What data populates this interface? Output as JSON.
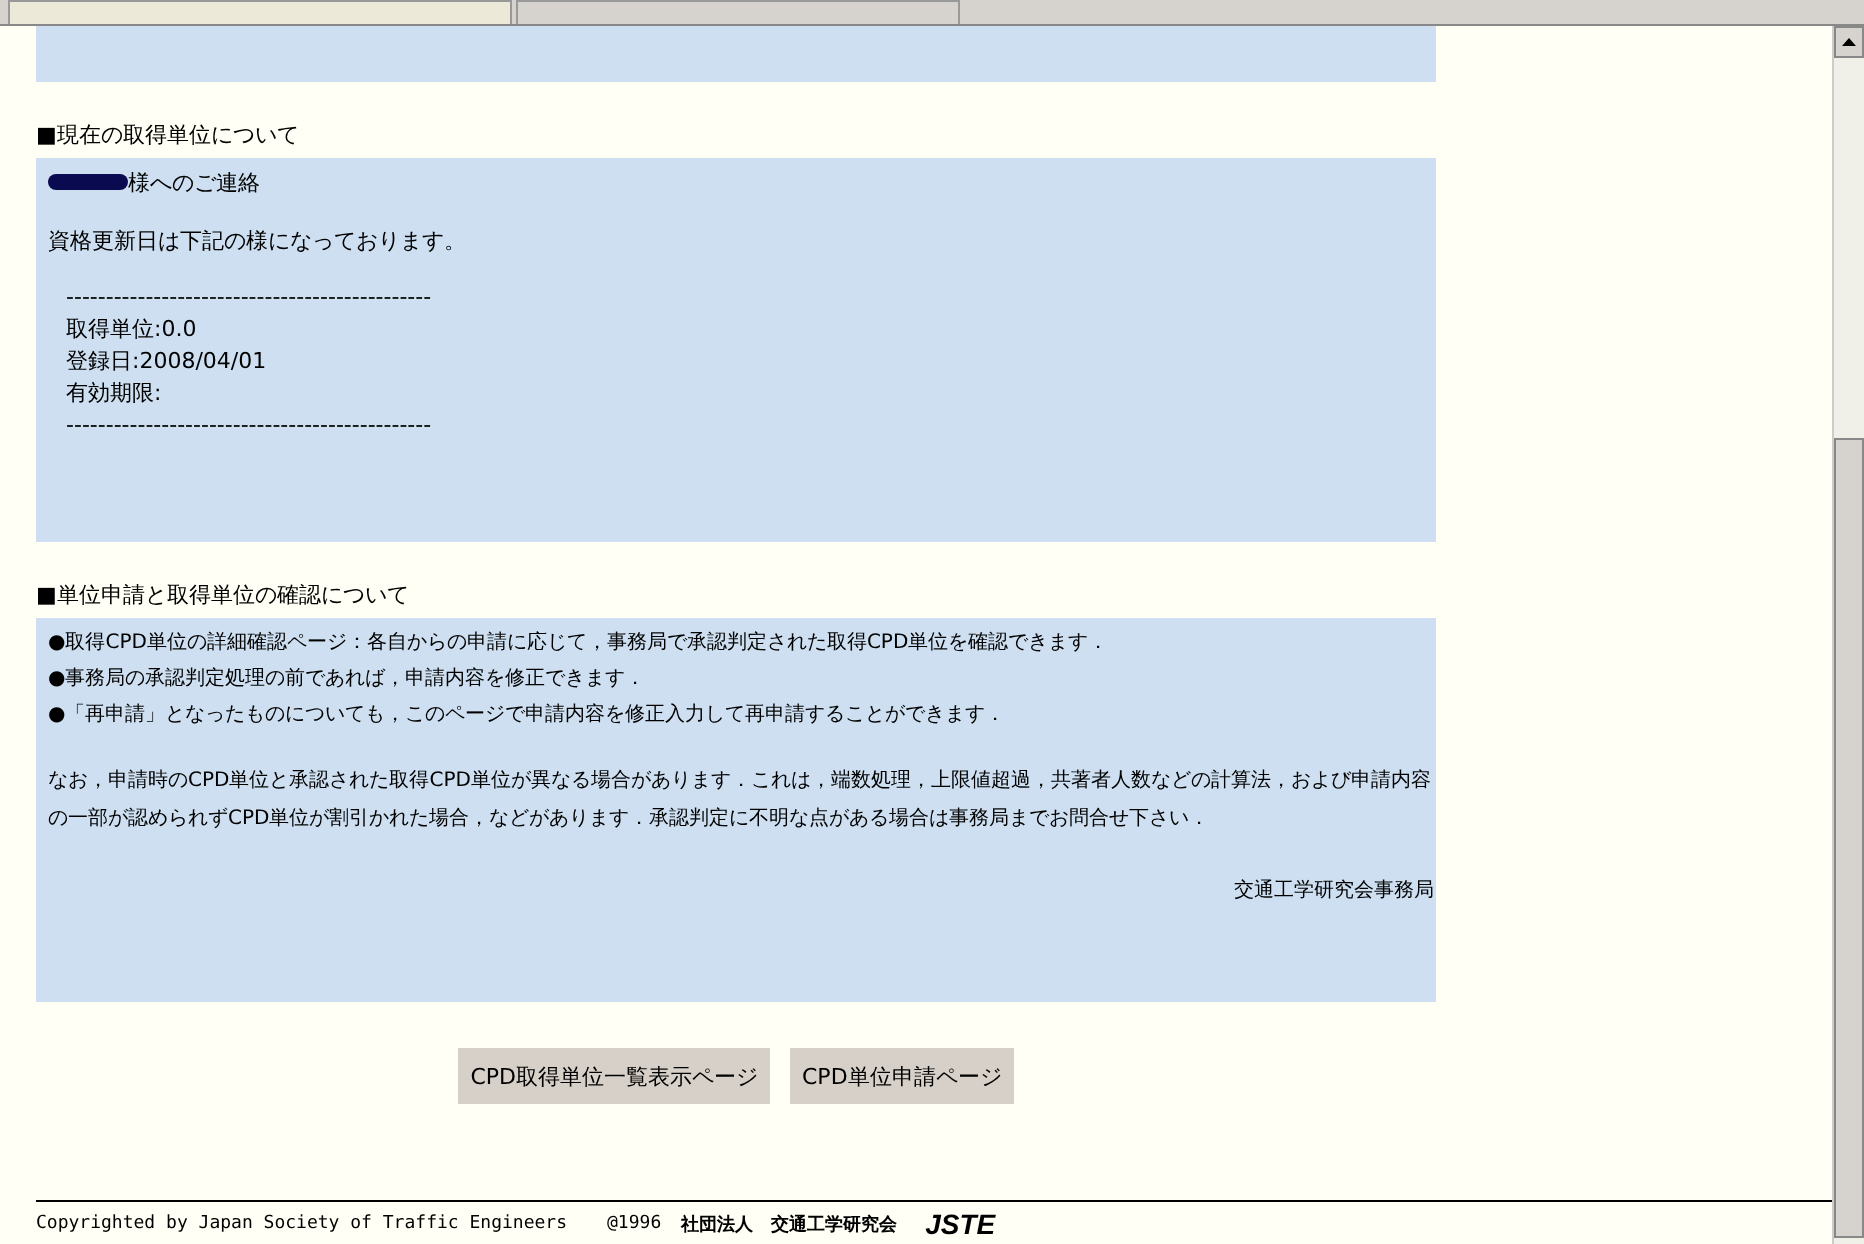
{
  "section_current": {
    "heading": "■現在の取得単位について",
    "greeting": "様へのご連絡",
    "intro": "資格更新日は下記の様になっております。",
    "separator": "----------------------------------------------",
    "lines": [
      "取得単位:0.0",
      "登録日:2008/04/01",
      "有効期限:"
    ]
  },
  "section_apply": {
    "heading": "■単位申請と取得単位の確認について",
    "bullets": [
      "●取得CPD単位の詳細確認ページ：各自からの申請に応じて，事務局で承認判定された取得CPD単位を確認できます．",
      "●事務局の承認判定処理の前であれば，申請内容を修正できます．",
      "●「再申請」となったものについても，このページで申請内容を修正入力して再申請することができます．"
    ],
    "note": "なお，申請時のCPD単位と承認された取得CPD単位が異なる場合があります．これは，端数処理，上限値超過，共著者人数などの計算法，および申請内容の一部が認められずCPD単位が割引かれた場合，などがあります．承認判定に不明な点がある場合は事務局までお問合せ下さい．",
    "signature": "交通工学研究会事務局"
  },
  "buttons": [
    "CPD取得単位一覧表示ページ",
    "CPD単位申請ページ"
  ],
  "footer": {
    "copyright": "Copyrighted by Japan Society of Traffic Engineers",
    "year": "@1996",
    "org": "社団法人　交通工学研究会",
    "logo": "JSTE"
  }
}
